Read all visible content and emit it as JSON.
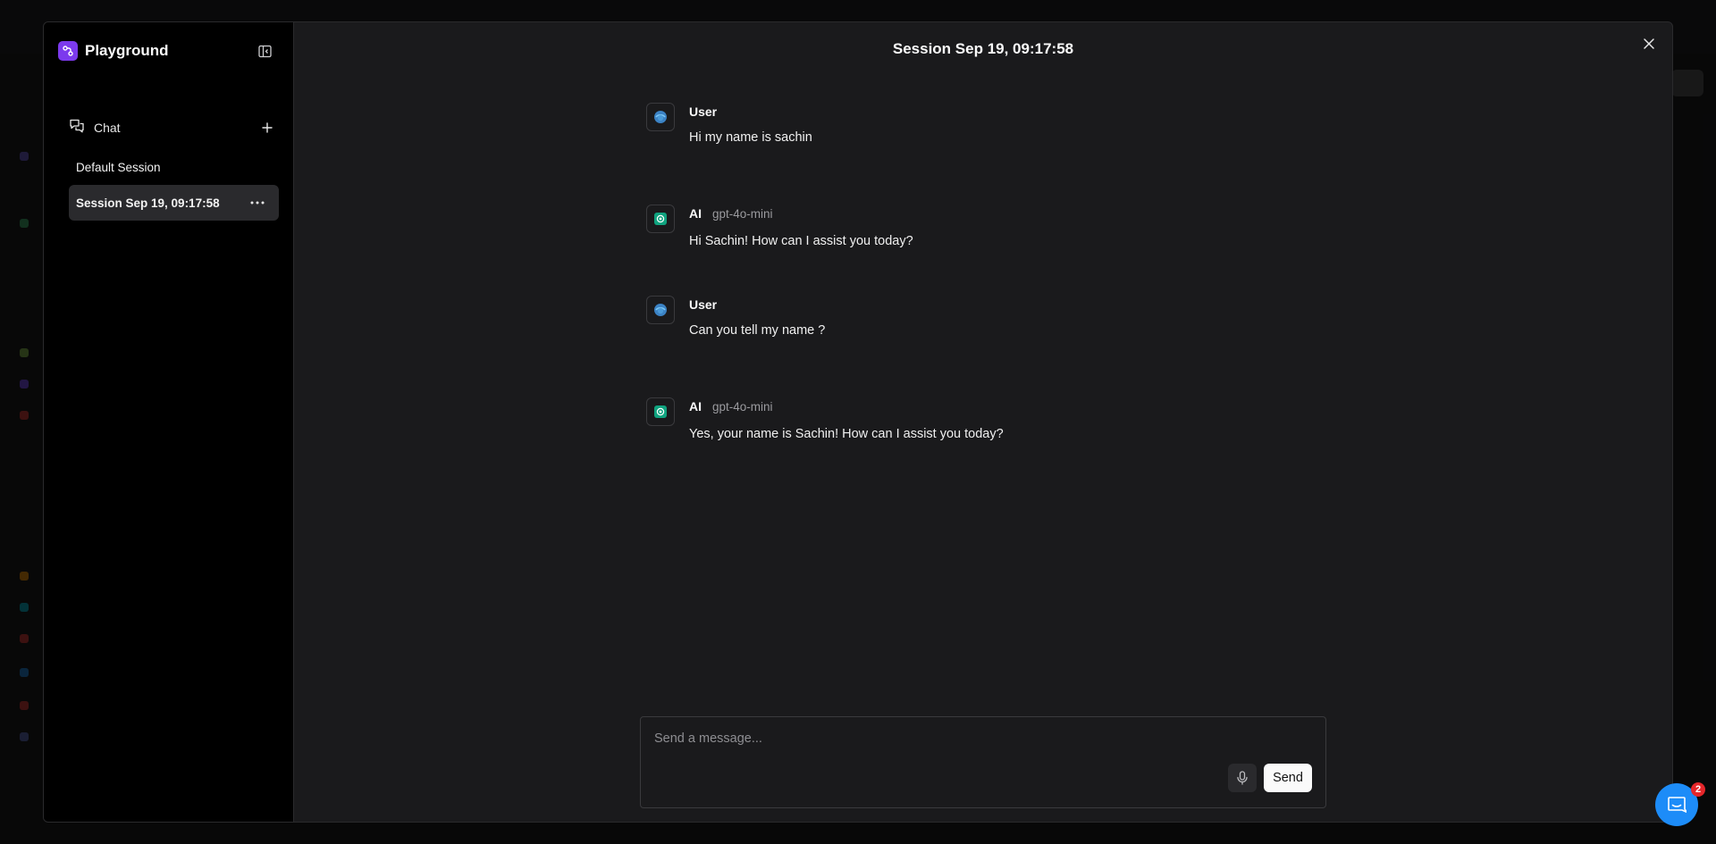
{
  "colors": {
    "accent": "#7c3aed",
    "ai_avatar": "#10a37f",
    "help_button": "#1d8cf8",
    "badge": "#e5262a"
  },
  "sidebar": {
    "app_title": "Playground",
    "logo_icon": "playground-logo-icon",
    "collapse_icon": "sidebar-collapse-icon",
    "chat_label": "Chat",
    "chat_icon": "chat-bubbles-icon",
    "add_icon": "plus-icon",
    "sessions": [
      {
        "label": "Default Session",
        "active": false
      },
      {
        "label": "Session Sep 19, 09:17:58",
        "active": true
      }
    ],
    "more_icon": "ellipsis-icon"
  },
  "main": {
    "title": "Session Sep 19, 09:17:58",
    "close_icon": "close-icon",
    "messages": [
      {
        "sender": "User",
        "model": "",
        "text": "Hi my name is sachin"
      },
      {
        "sender": "AI",
        "model": "gpt-4o-mini",
        "text": "Hi Sachin! How can I assist you today?"
      },
      {
        "sender": "User",
        "model": "",
        "text": "Can you tell my name ?"
      },
      {
        "sender": "AI",
        "model": "gpt-4o-mini",
        "text": "Yes, your name is Sachin! How can I assist you today?"
      }
    ]
  },
  "composer": {
    "placeholder": "Send a message...",
    "value": "",
    "mic_icon": "microphone-icon",
    "send_label": "Send"
  },
  "help": {
    "icon": "chat-support-icon",
    "badge_count": "2"
  }
}
